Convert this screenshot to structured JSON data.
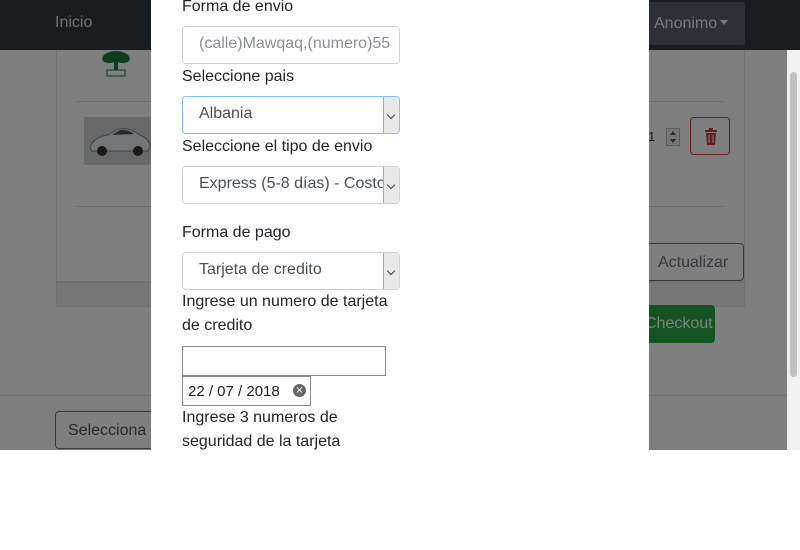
{
  "navbar": {
    "home_label": "Inicio",
    "user_label": "Anonimo"
  },
  "cart": {
    "update_label": "Actualizar",
    "checkout_label": "Checkout",
    "quantity": "1",
    "select_label": "Selecciona"
  },
  "form": {
    "shipping_address_label": "Forma de envio",
    "shipping_address_value": "(calle)Mawqaq,(numero)55",
    "country_label": "Seleccione pais",
    "country_value": "Albania",
    "shipping_type_label": "Seleccione el tipo de envio",
    "shipping_type_value": "Express (5-8 días) - Costo",
    "payment_label": "Forma de pago",
    "payment_value": "Tarjeta de credito",
    "card_number_label_1": "Ingrese un numero de tarjeta",
    "card_number_label_2": "de credito",
    "card_number_value": "",
    "expiry_value": "22 / 07 / 2018",
    "security_label_1": "Ingrese 3 numeros de",
    "security_label_2": "seguridad de la tarjeta"
  },
  "icons": {
    "delete": "trash-icon",
    "clear": "clear-icon",
    "dropdown": "chevron-down-icon"
  },
  "colors": {
    "navbar": "#343a40",
    "danger": "#dc3545",
    "success": "#28a745",
    "focus": "#80bdff"
  }
}
